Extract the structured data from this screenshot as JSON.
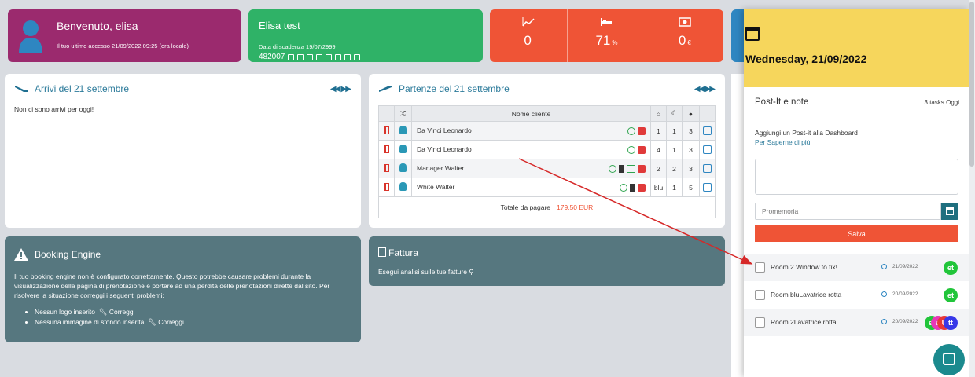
{
  "welcome": {
    "title": "Benvenuto, elisa",
    "last_access": "Il tuo ultimo accesso 21/09/2022 09:25 (ora locale)"
  },
  "hotel": {
    "name": "Elisa test",
    "expiry": "Data di scadenza 19/07/2999",
    "code": "482007"
  },
  "stats": [
    {
      "icon": "chart-line-icon",
      "value": "0",
      "unit": ""
    },
    {
      "icon": "bed-icon",
      "value": "71",
      "unit": "%"
    },
    {
      "icon": "money-icon",
      "value": "0",
      "unit": "€"
    }
  ],
  "arrivi": {
    "title": "Arrivi del 21 settembre",
    "message": "Non ci sono arrivi per oggi!"
  },
  "partenze": {
    "title": "Partenze del 21 settembre",
    "columns": {
      "name": "Nome cliente"
    },
    "rows": [
      {
        "name": "Da Vinci Leonardo",
        "room": "1",
        "nights": "1",
        "guests": "3"
      },
      {
        "name": "Da Vinci Leonardo",
        "room": "4",
        "nights": "1",
        "guests": "3"
      },
      {
        "name": "Manager Walter",
        "room": "2",
        "nights": "2",
        "guests": "3"
      },
      {
        "name": "White Walter",
        "room": "blu",
        "nights": "1",
        "guests": "5"
      }
    ],
    "total_label": "Totale da pagare",
    "total_amount": "179.50 EUR"
  },
  "booking_engine": {
    "title": "Booking Engine",
    "text": "Il tuo booking engine non è configurato correttamente. Questo potrebbe causare problemi durante la visualizzazione della pagina di prenotazione e portare ad una perdita delle prenotazioni dirette dal sito. Per risolvere la situazione correggi i seguenti problemi:",
    "problems": [
      {
        "label": "Nessun logo inserito",
        "action": "Correggi"
      },
      {
        "label": "Nessuna immagine di sfondo inserita",
        "action": "Correggi"
      }
    ]
  },
  "fattura": {
    "title": "Fattura",
    "text": "Esegui analisi sulle tue fatture"
  },
  "drawer": {
    "date": "Wednesday, 21/09/2022",
    "title": "Post-It e note",
    "tasks_count": "3 tasks Oggi",
    "add_text": "Aggiungi un Post-it alla Dashboard",
    "more_link": "Per Saperne di più",
    "reminder_placeholder": "Promemoria",
    "save_label": "Salva",
    "tasks": [
      {
        "title": "Room 2 Window to fix!",
        "date": "21/09/2022"
      },
      {
        "title": "Room bluLavatrice rotta",
        "date": "20/09/2022"
      },
      {
        "title": "Room 2Lavatrice rotta",
        "date": "20/09/2022"
      }
    ]
  },
  "colors": {
    "purple": "#9b2a6e",
    "green": "#2fb267",
    "orange": "#ef5436",
    "slate": "#56777f",
    "yellow": "#f6d65c"
  }
}
